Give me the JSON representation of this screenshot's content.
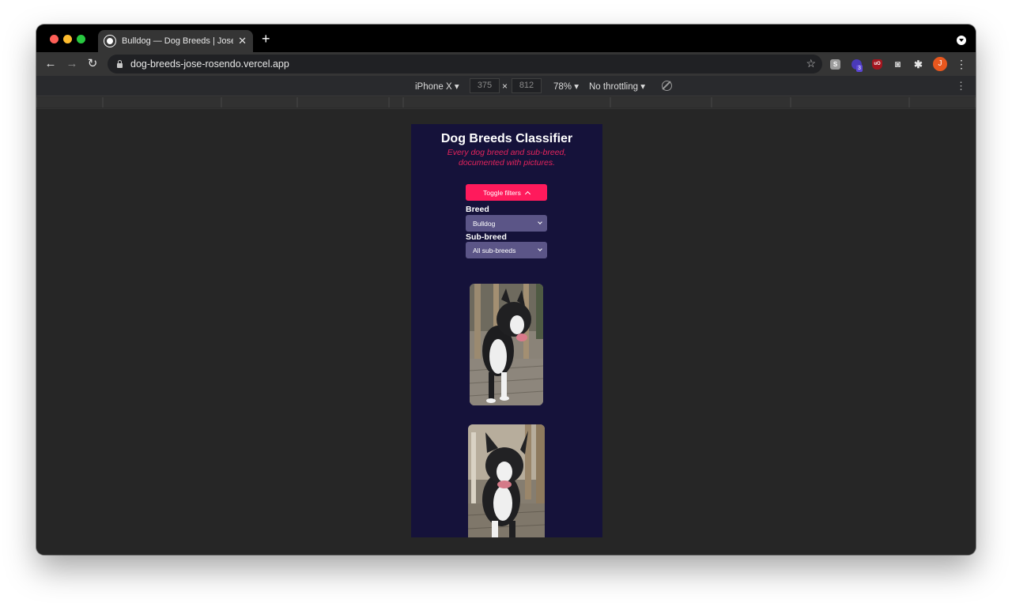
{
  "window": {
    "tab_title": "Bulldog — Dog Breeds | Jose R",
    "tab_close": "✕",
    "new_tab": "+",
    "url": "dog-breeds-jose-rosendo.vercel.app",
    "avatar_initial": "J",
    "extension_badge": "3"
  },
  "devtools": {
    "device": "iPhone X ▾",
    "width": "375",
    "height": "812",
    "times": "×",
    "zoom": "78% ▾",
    "throttling": "No throttling ▾"
  },
  "app": {
    "title": "Dog Breeds Classifier",
    "subtitle": "Every dog breed and sub-breed, documented with pictures.",
    "toggle_label": "Toggle filters",
    "breed_label": "Breed",
    "breed_value": "Bulldog",
    "subbreed_label": "Sub-breed",
    "subbreed_value": "All sub-breeds"
  },
  "colors": {
    "accent": "#ff1a5c",
    "subtitle": "#e5245c",
    "app_background": "#15123a",
    "select_background": "#5b5587"
  },
  "icons": [
    "back-arrow-icon",
    "forward-arrow-icon",
    "reload-icon",
    "lock-icon",
    "star-icon",
    "puzzle-icon",
    "kebab-menu-icon",
    "rotate-icon",
    "chevron-up-icon",
    "chevron-down-icon"
  ]
}
